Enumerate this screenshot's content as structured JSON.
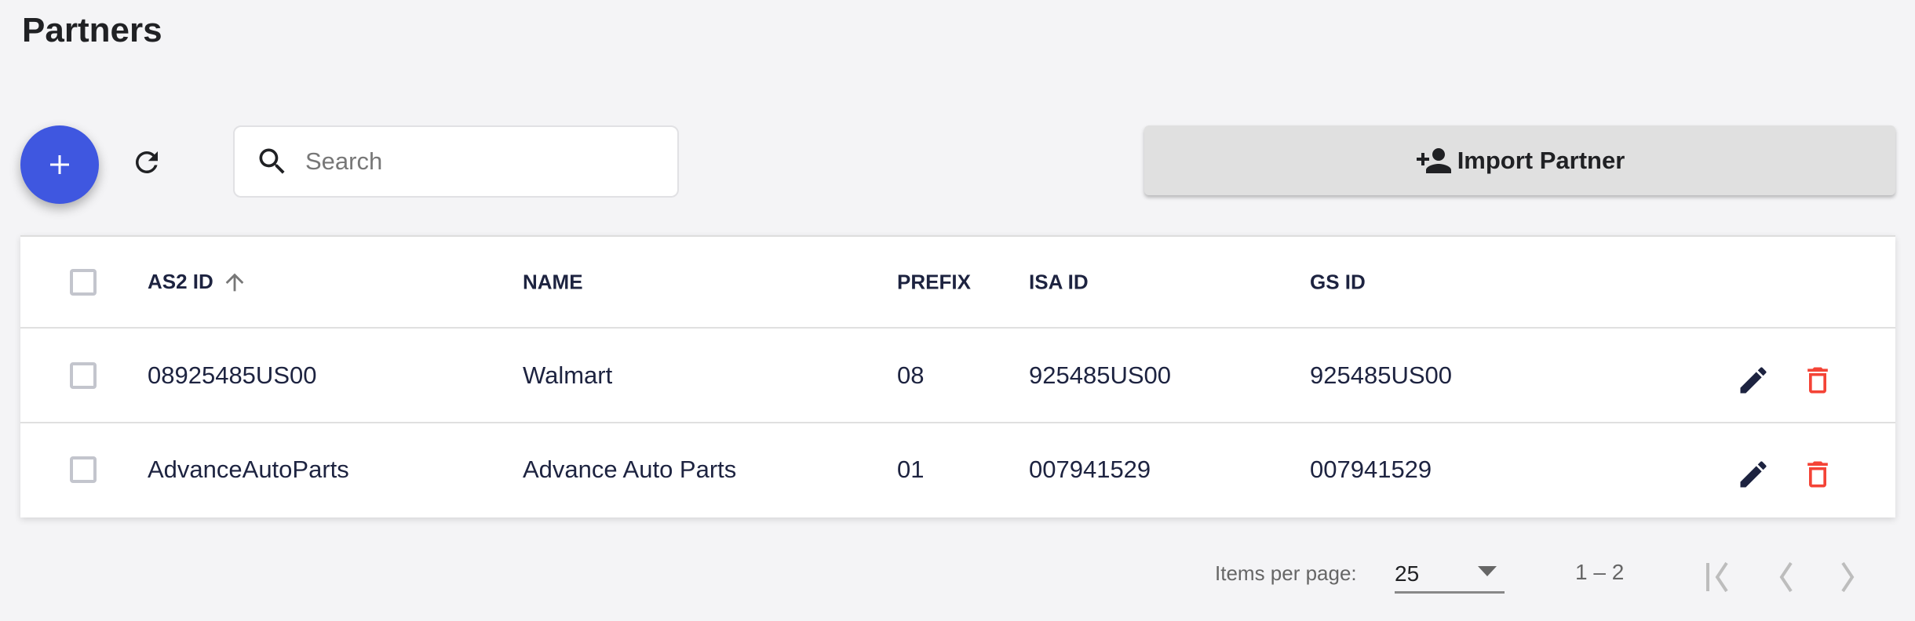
{
  "page": {
    "title": "Partners"
  },
  "toolbar": {
    "add_icon": "plus-icon",
    "refresh_icon": "refresh-icon",
    "search_placeholder": "Search",
    "search_value": "",
    "import_label": "Import Partner",
    "import_icon": "person-add-icon"
  },
  "colors": {
    "accent": "#3f57e0",
    "delete": "#f44336",
    "text": "#1d2340"
  },
  "table": {
    "columns": [
      "AS2 ID",
      "NAME",
      "PREFIX",
      "ISA ID",
      "GS ID"
    ],
    "sort": {
      "column": "AS2 ID",
      "direction": "ascending"
    },
    "rows": [
      {
        "as2_id": "08925485US00",
        "name": "Walmart",
        "prefix": "08",
        "isa_id": "925485US00",
        "gs_id": "925485US00"
      },
      {
        "as2_id": "AdvanceAutoParts",
        "name": "Advance Auto Parts",
        "prefix": "01",
        "isa_id": "007941529",
        "gs_id": "007941529"
      }
    ]
  },
  "pagination": {
    "items_per_page_label": "Items per page:",
    "items_per_page": "25",
    "range": "1 – 2"
  }
}
